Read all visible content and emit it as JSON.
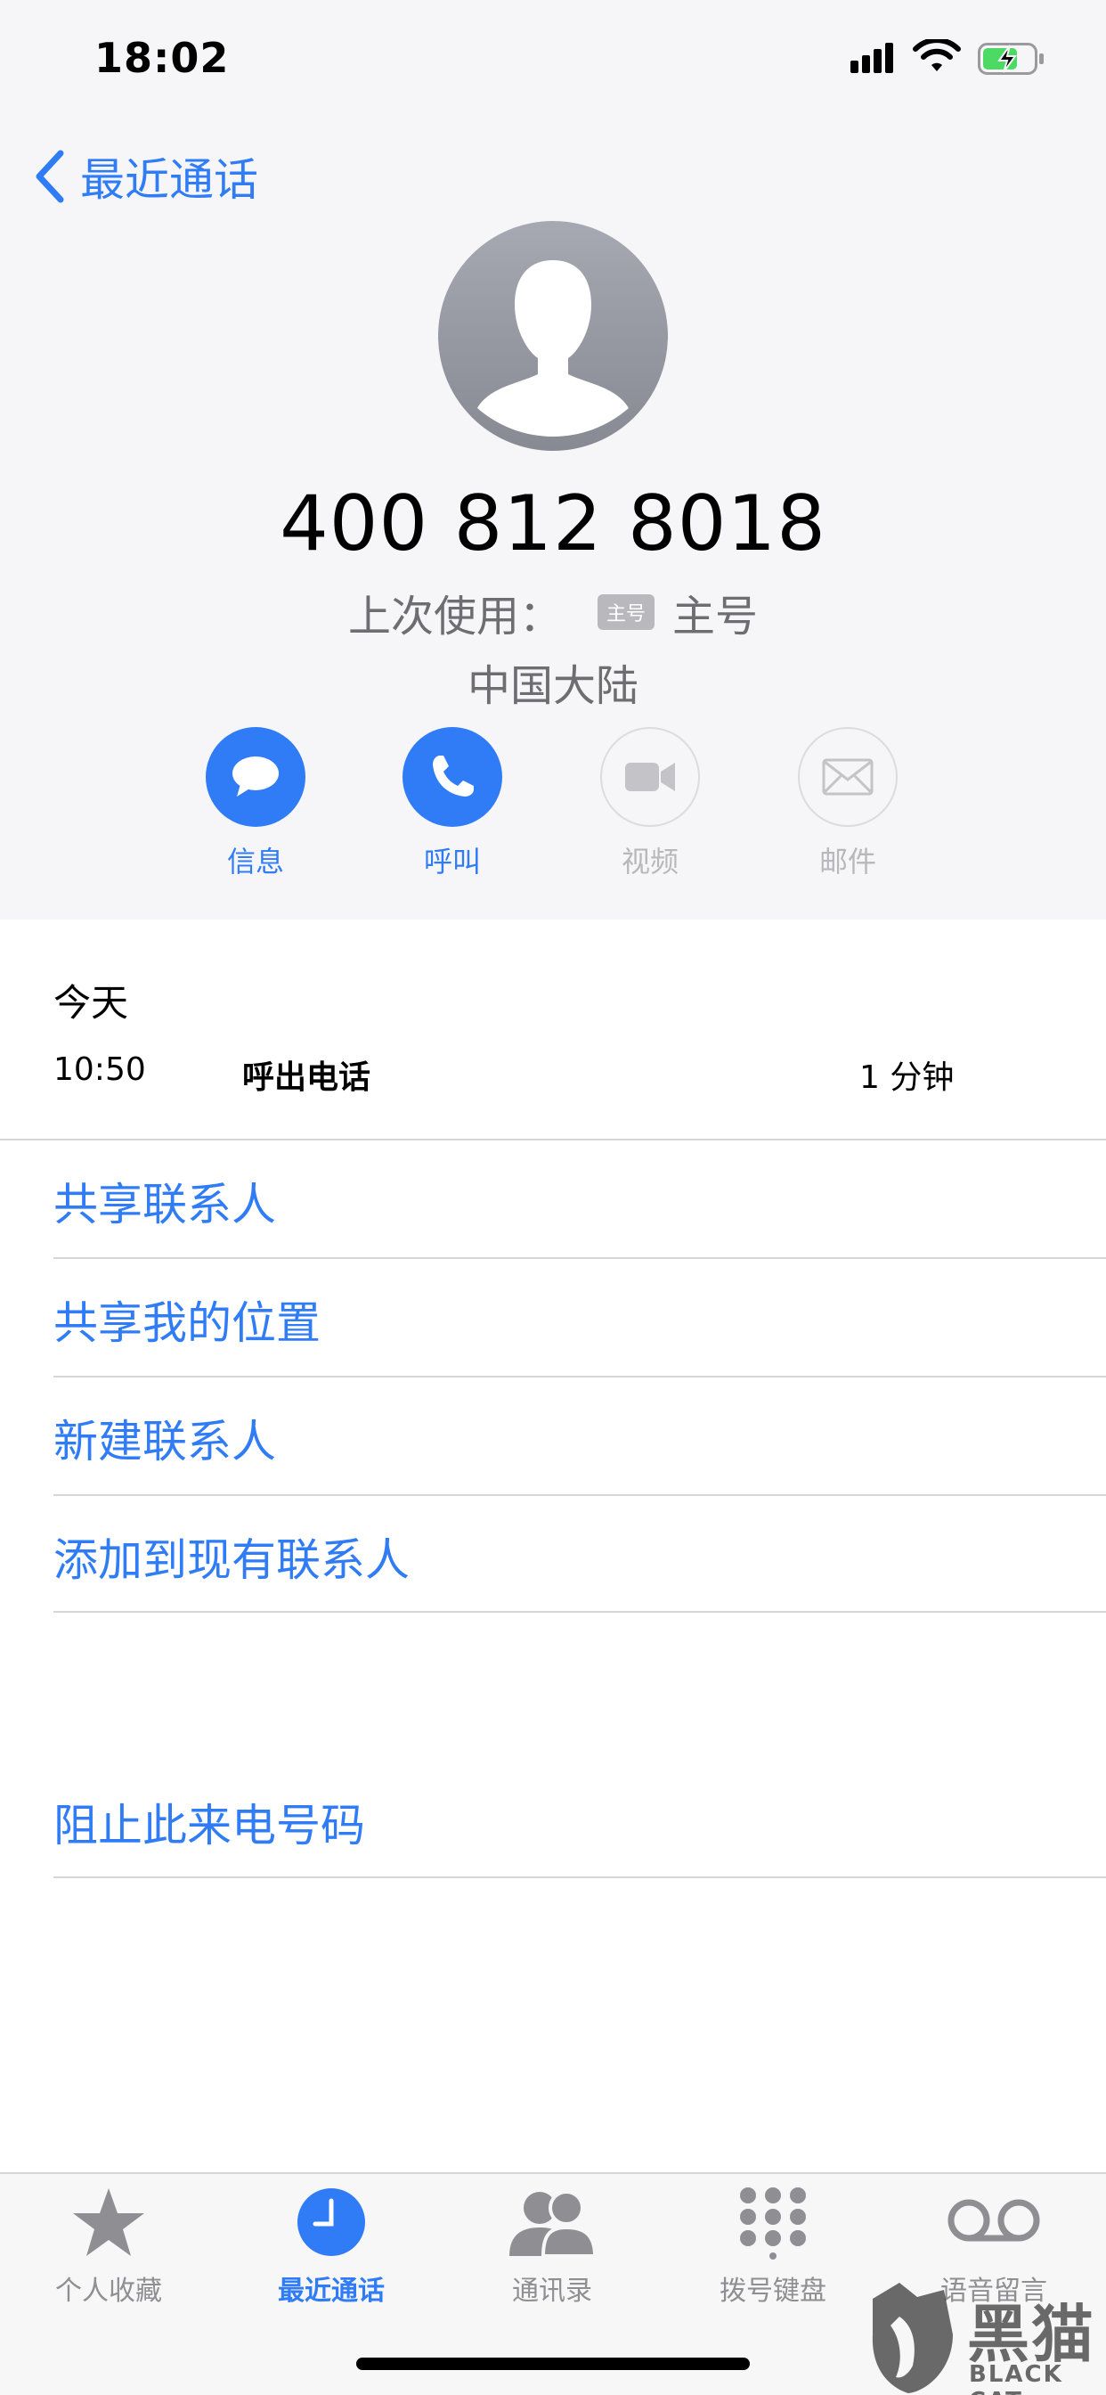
{
  "status_bar": {
    "time": "18:02"
  },
  "nav": {
    "back_label": "最近通话"
  },
  "contact": {
    "number": "400 812 8018",
    "last_used_label": "上次使用：",
    "sim_badge": "主号",
    "sim_name": "主号",
    "region": "中国大陆"
  },
  "actions": [
    {
      "label": "信息",
      "icon": "message-icon",
      "enabled": true
    },
    {
      "label": "呼叫",
      "icon": "phone-icon",
      "enabled": true
    },
    {
      "label": "视频",
      "icon": "video-icon",
      "enabled": false
    },
    {
      "label": "邮件",
      "icon": "mail-icon",
      "enabled": false
    }
  ],
  "history": {
    "date": "今天",
    "entries": [
      {
        "time": "10:50",
        "type": "呼出电话",
        "duration": "1 分钟"
      }
    ]
  },
  "options": [
    "共享联系人",
    "共享我的位置",
    "新建联系人",
    "添加到现有联系人"
  ],
  "block_option": "阻止此来电号码",
  "tabs": [
    {
      "label": "个人收藏",
      "icon": "star-icon",
      "active": false
    },
    {
      "label": "最近通话",
      "icon": "clock-icon",
      "active": true
    },
    {
      "label": "通讯录",
      "icon": "contacts-icon",
      "active": false
    },
    {
      "label": "拨号键盘",
      "icon": "keypad-icon",
      "active": false
    },
    {
      "label": "语音留言",
      "icon": "voicemail-icon",
      "active": false
    }
  ],
  "watermark": {
    "cn": "黑猫",
    "en": "BLACK CAT"
  },
  "colors": {
    "accent": "#2f7cf6",
    "header_bg": "#f6f6f9",
    "separator": "#d6d6da",
    "inactive": "#b8b8bc"
  }
}
